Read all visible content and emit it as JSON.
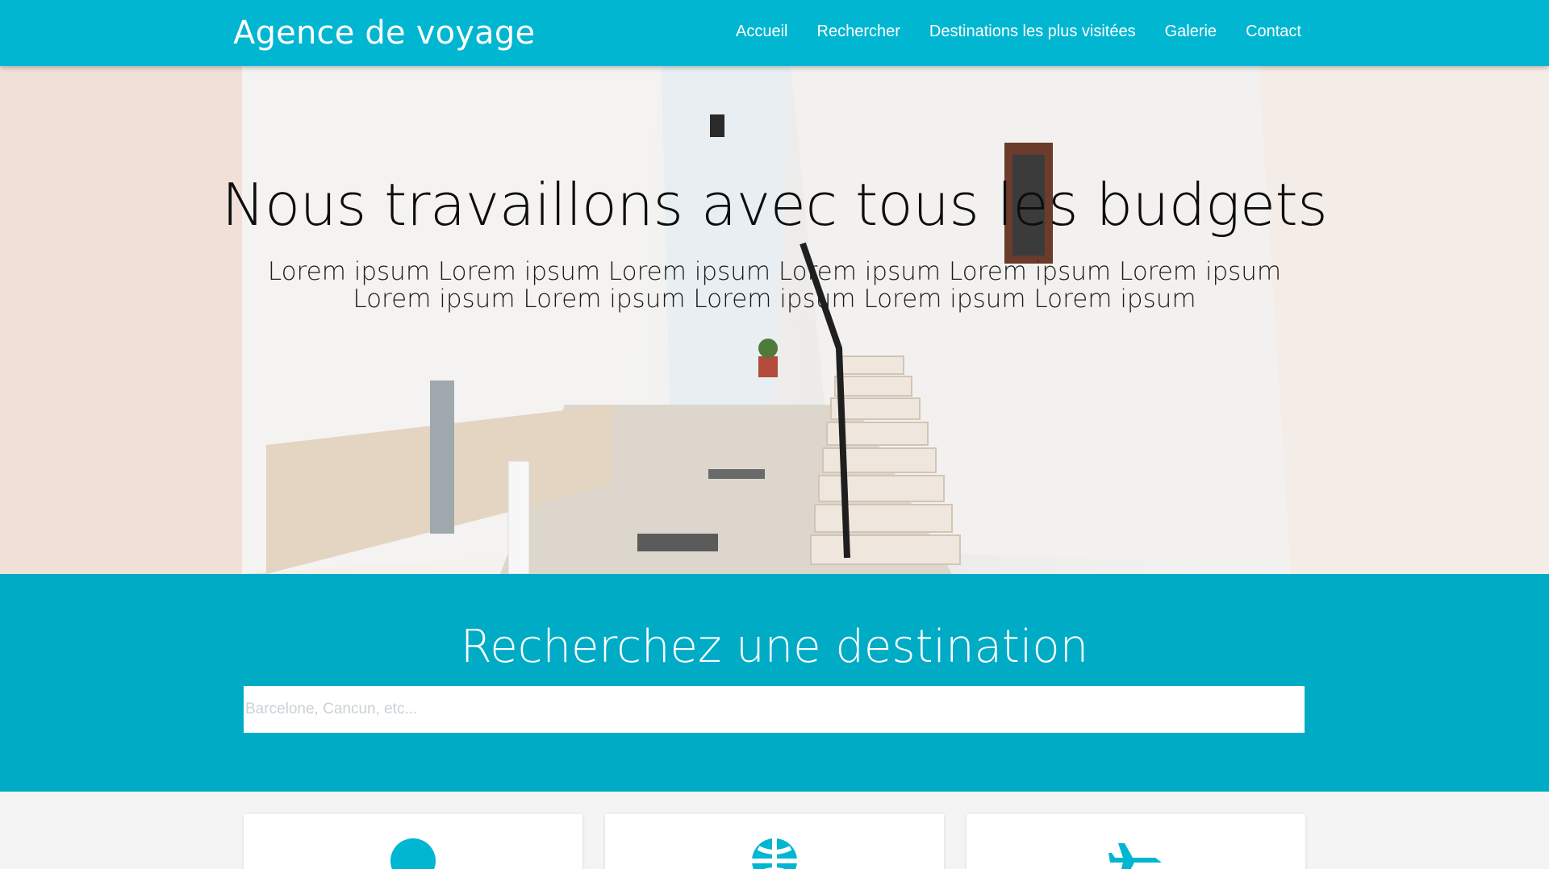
{
  "header": {
    "brand": "Agence de voyage",
    "nav": [
      {
        "label": "Accueil"
      },
      {
        "label": "Rechercher"
      },
      {
        "label": "Destinations les plus visitées"
      },
      {
        "label": "Galerie"
      },
      {
        "label": "Contact"
      }
    ]
  },
  "hero": {
    "title": "Nous travaillons avec tous les budgets",
    "subtitle": "Lorem ipsum Lorem ipsum Lorem ipsum Lorem ipsum Lorem ipsum Lorem ipsum Lorem ipsum Lorem ipsum Lorem ipsum Lorem ipsum Lorem ipsum"
  },
  "search": {
    "title": "Recherchez une destination",
    "placeholder": "Barcelone, Cancun, etc..."
  },
  "cards": [
    {
      "icon": "map-pin-icon"
    },
    {
      "icon": "globe-icon"
    },
    {
      "icon": "airplane-icon"
    }
  ],
  "colors": {
    "primary": "#00b6d1",
    "search_bg": "#00abc6",
    "cards_bg": "#f4f4f4"
  }
}
